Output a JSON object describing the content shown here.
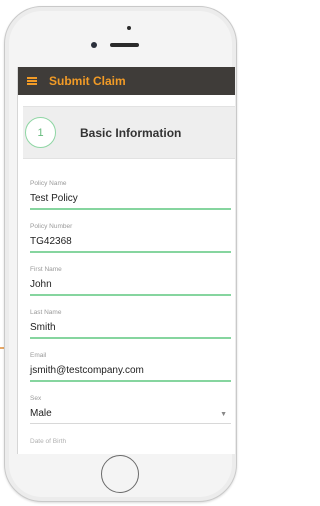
{
  "app": {
    "title": "Submit Claim"
  },
  "step": {
    "number": "1",
    "title": "Basic Information"
  },
  "form": {
    "fields": [
      {
        "label": "Policy Name",
        "value": "Test Policy"
      },
      {
        "label": "Policy Number",
        "value": "TG42368"
      },
      {
        "label": "First Name",
        "value": "John"
      },
      {
        "label": "Last Name",
        "value": "Smith"
      },
      {
        "label": "Email",
        "value": "jsmith@testcompany.com"
      },
      {
        "label": "Sex",
        "value": "Male"
      },
      {
        "label": "Date of Birth",
        "value": ""
      }
    ]
  },
  "colors": {
    "appbar": "#3f3c39",
    "accent": "#f29b26",
    "underline": "#86d59f"
  },
  "icons": [
    "menu-icon",
    "dropdown-caret-icon"
  ]
}
